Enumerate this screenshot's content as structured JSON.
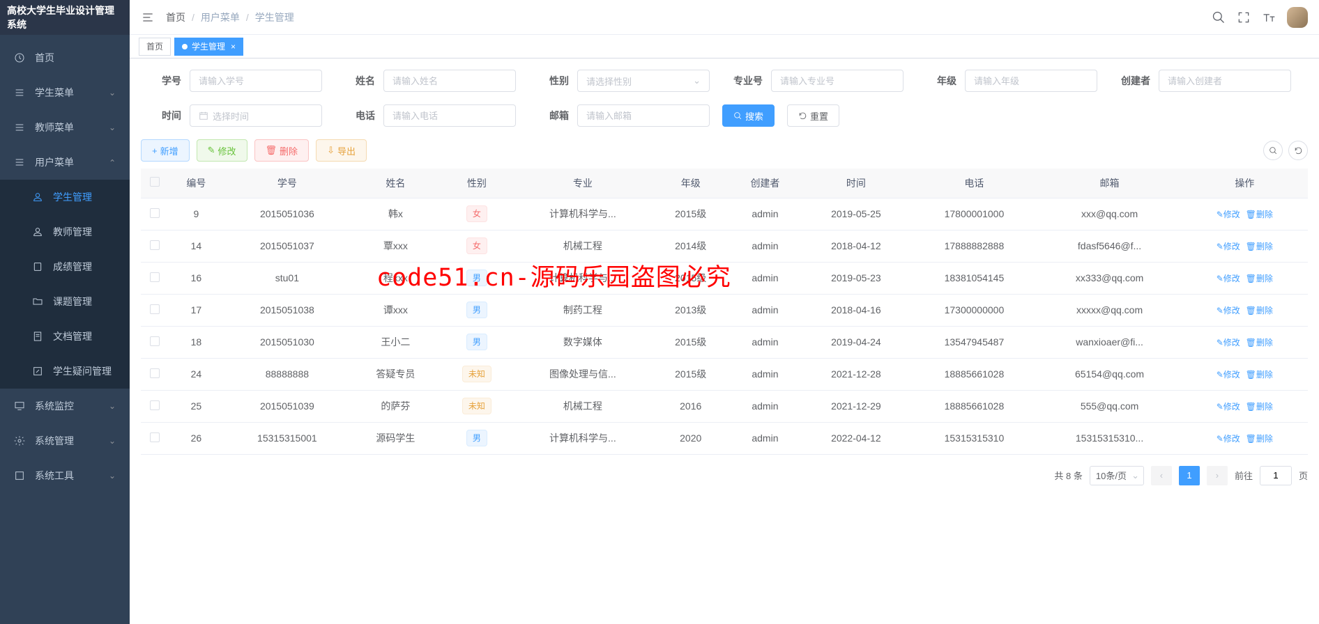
{
  "app_title": "高校大学生毕业设计管理系统",
  "breadcrumb": {
    "home": "首页",
    "parent": "用户菜单",
    "current": "学生管理"
  },
  "tabs": {
    "home": "首页",
    "active": "学生管理"
  },
  "sidebar": {
    "home": "首页",
    "student_menu": "学生菜单",
    "teacher_menu": "教师菜单",
    "user_menu": "用户菜单",
    "user_menu_items": {
      "student_mgmt": "学生管理",
      "teacher_mgmt": "教师管理",
      "grade_mgmt": "成绩管理",
      "topic_mgmt": "课题管理",
      "doc_mgmt": "文档管理",
      "question_mgmt": "学生疑问管理"
    },
    "system_monitor": "系统监控",
    "system_mgmt": "系统管理",
    "system_tools": "系统工具"
  },
  "search": {
    "student_no_label": "学号",
    "student_no_ph": "请输入学号",
    "name_label": "姓名",
    "name_ph": "请输入姓名",
    "gender_label": "性别",
    "gender_ph": "请选择性别",
    "major_no_label": "专业号",
    "major_no_ph": "请输入专业号",
    "grade_label": "年级",
    "grade_ph": "请输入年级",
    "creator_label": "创建者",
    "creator_ph": "请输入创建者",
    "time_label": "时间",
    "time_ph": "选择时间",
    "phone_label": "电话",
    "phone_ph": "请输入电话",
    "email_label": "邮箱",
    "email_ph": "请输入邮箱",
    "search_btn": "搜索",
    "reset_btn": "重置"
  },
  "toolbar": {
    "add": "新增",
    "edit": "修改",
    "delete": "删除",
    "export": "导出"
  },
  "columns": {
    "id": "编号",
    "student_no": "学号",
    "name": "姓名",
    "gender": "性别",
    "major": "专业",
    "grade": "年级",
    "creator": "创建者",
    "time": "时间",
    "phone": "电话",
    "email": "邮箱",
    "operation": "操作"
  },
  "gender_tags": {
    "female": "女",
    "male": "男",
    "unknown": "未知"
  },
  "row_ops": {
    "edit": "修改",
    "delete": "删除"
  },
  "rows": [
    {
      "id": "9",
      "sno": "2015051036",
      "name": "韩x",
      "gender": "female",
      "major": "计算机科学与...",
      "grade": "2015级",
      "creator": "admin",
      "time": "2019-05-25",
      "phone": "17800001000",
      "email": "xxx@qq.com"
    },
    {
      "id": "14",
      "sno": "2015051037",
      "name": "覃xxx",
      "gender": "female",
      "major": "机械工程",
      "grade": "2014级",
      "creator": "admin",
      "time": "2018-04-12",
      "phone": "17888882888",
      "email": "fdasf5646@f..."
    },
    {
      "id": "16",
      "sno": "stu01",
      "name": "程xxx",
      "gender": "male",
      "major": "计算机科学与...",
      "grade": "2015级",
      "creator": "admin",
      "time": "2019-05-23",
      "phone": "18381054145",
      "email": "xx333@qq.com"
    },
    {
      "id": "17",
      "sno": "2015051038",
      "name": "谭xxx",
      "gender": "male",
      "major": "制药工程",
      "grade": "2013级",
      "creator": "admin",
      "time": "2018-04-16",
      "phone": "17300000000",
      "email": "xxxxx@qq.com"
    },
    {
      "id": "18",
      "sno": "2015051030",
      "name": "王小二",
      "gender": "male",
      "major": "数字媒体",
      "grade": "2015级",
      "creator": "admin",
      "time": "2019-04-24",
      "phone": "13547945487",
      "email": "wanxioaer@fi..."
    },
    {
      "id": "24",
      "sno": "88888888",
      "name": "答疑专员",
      "gender": "unknown",
      "major": "图像处理与信...",
      "grade": "2015级",
      "creator": "admin",
      "time": "2021-12-28",
      "phone": "18885661028",
      "email": "65154@qq.com"
    },
    {
      "id": "25",
      "sno": "2015051039",
      "name": "的萨芬",
      "gender": "unknown",
      "major": "机械工程",
      "grade": "2016",
      "creator": "admin",
      "time": "2021-12-29",
      "phone": "18885661028",
      "email": "555@qq.com"
    },
    {
      "id": "26",
      "sno": "15315315001",
      "name": "源码学生",
      "gender": "male",
      "major": "计算机科学与...",
      "grade": "2020",
      "creator": "admin",
      "time": "2022-04-12",
      "phone": "15315315310",
      "email": "15315315310..."
    }
  ],
  "pagination": {
    "total": "共 8 条",
    "per_page": "10条/页",
    "current": "1",
    "goto_prefix": "前往",
    "goto_suffix": "页",
    "goto_value": "1"
  },
  "watermark": "code51.cn-源码乐园盗图必究"
}
